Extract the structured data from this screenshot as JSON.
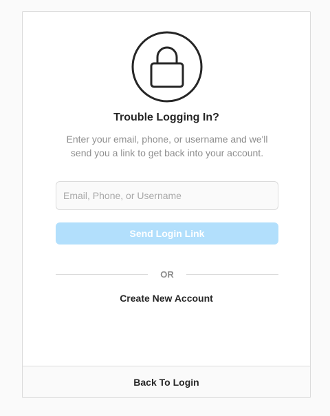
{
  "icon": "lock-icon",
  "colors": {
    "primary_disabled": "#b2dffc",
    "text_primary": "#262626",
    "text_secondary": "#8e8e8e",
    "border": "#dbdbdb",
    "background": "#fafafa"
  },
  "title": "Trouble Logging In?",
  "description": "Enter your email, phone, or username and we'll send you a link to get back into your account.",
  "form": {
    "identifier_placeholder": "Email, Phone, or Username",
    "identifier_value": "",
    "send_label": "Send Login Link"
  },
  "divider_label": "OR",
  "create_account_label": "Create New Account",
  "footer": {
    "back_label": "Back To Login"
  }
}
